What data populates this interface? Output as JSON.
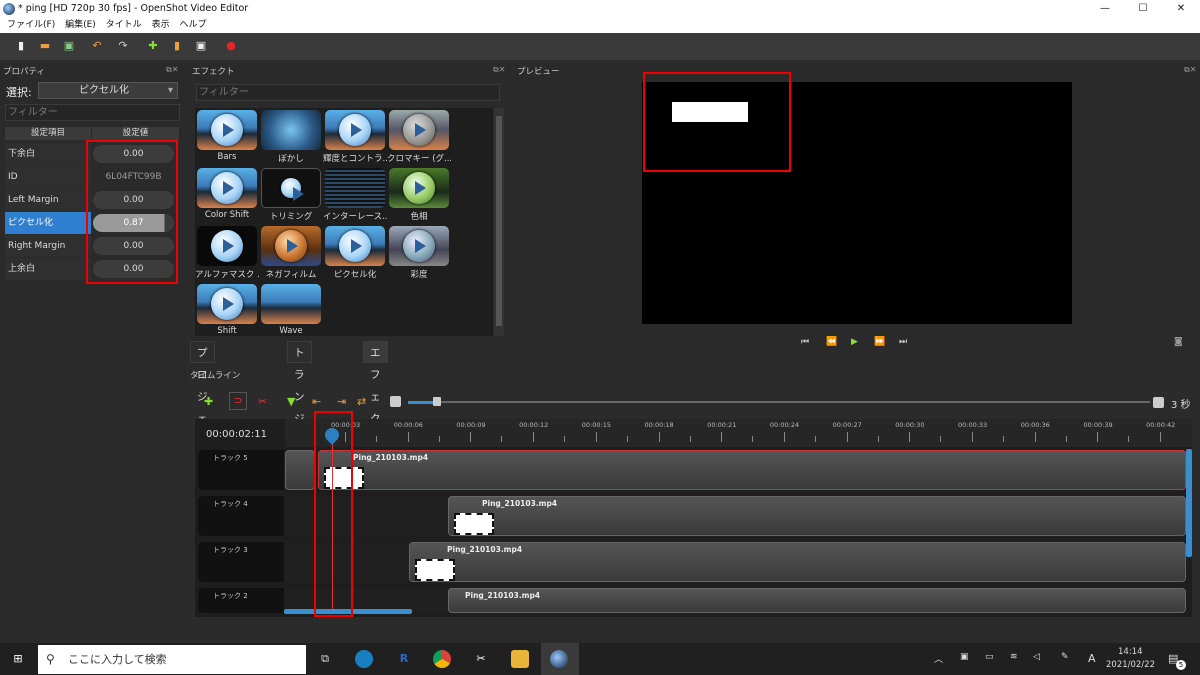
{
  "window": {
    "title": "* ping [HD 720p 30 fps] - OpenShot Video Editor",
    "min": "—",
    "max": "☐",
    "close": "✕"
  },
  "menu": [
    "ファイル(F)",
    "編集(E)",
    "タイトル",
    "表示",
    "ヘルプ"
  ],
  "properties": {
    "title": "プロパティ",
    "select_label": "選択:",
    "select_value": "ピクセル化",
    "filter_placeholder": "フィルター",
    "col_name": "設定項目",
    "col_value": "設定値",
    "rows": [
      {
        "name": "下余白",
        "value": "0.00"
      },
      {
        "name": "ID",
        "value": "6L04FTC99B"
      },
      {
        "name": "Left Margin",
        "value": "0.00"
      },
      {
        "name": "ピクセル化",
        "value": "0.87"
      },
      {
        "name": "Right Margin",
        "value": "0.00"
      },
      {
        "name": "上余白",
        "value": "0.00"
      }
    ]
  },
  "effects": {
    "title": "エフェクト",
    "filter_placeholder": "フィルター",
    "items": [
      "Bars",
      "ぼかし",
      "輝度とコントラ...",
      "クロマキー (グ...",
      "Color Shift",
      "トリミング",
      "インターレース...",
      "色相",
      "アルファマスク ...",
      "ネガフィルム",
      "ピクセル化",
      "彩度",
      "Shift",
      "Wave"
    ],
    "tabs": [
      "プロジェクトファイル",
      "トランジション",
      "エフェクト"
    ]
  },
  "preview": {
    "title": "プレビュー",
    "controls": [
      "⏮",
      "⏪",
      "▶",
      "⏩",
      "⏭"
    ]
  },
  "timeline": {
    "title": "タイムライン",
    "current_time": "00:00:02:11",
    "zoom_label": "3 秒",
    "ticks": [
      "00:00:03",
      "00:00:06",
      "00:00:09",
      "00:00:12",
      "00:00:15",
      "00:00:18",
      "00:00:21",
      "00:00:24",
      "00:00:27",
      "00:00:30",
      "00:00:33",
      "00:00:36",
      "00:00:39",
      "00:00:42"
    ],
    "tracks": [
      {
        "name": "トラック 5",
        "clip": "Ping_210103.mp4"
      },
      {
        "name": "トラック 4",
        "clip": "Ping_210103.mp4"
      },
      {
        "name": "トラック 3",
        "clip": "Ping_210103.mp4"
      },
      {
        "name": "トラック 2",
        "clip": "Ping_210103.mp4"
      }
    ]
  },
  "taskbar": {
    "search": "ここに入力して検索",
    "time": "14:14",
    "date": "2021/02/22",
    "ime": "A",
    "notif_count": "5"
  }
}
